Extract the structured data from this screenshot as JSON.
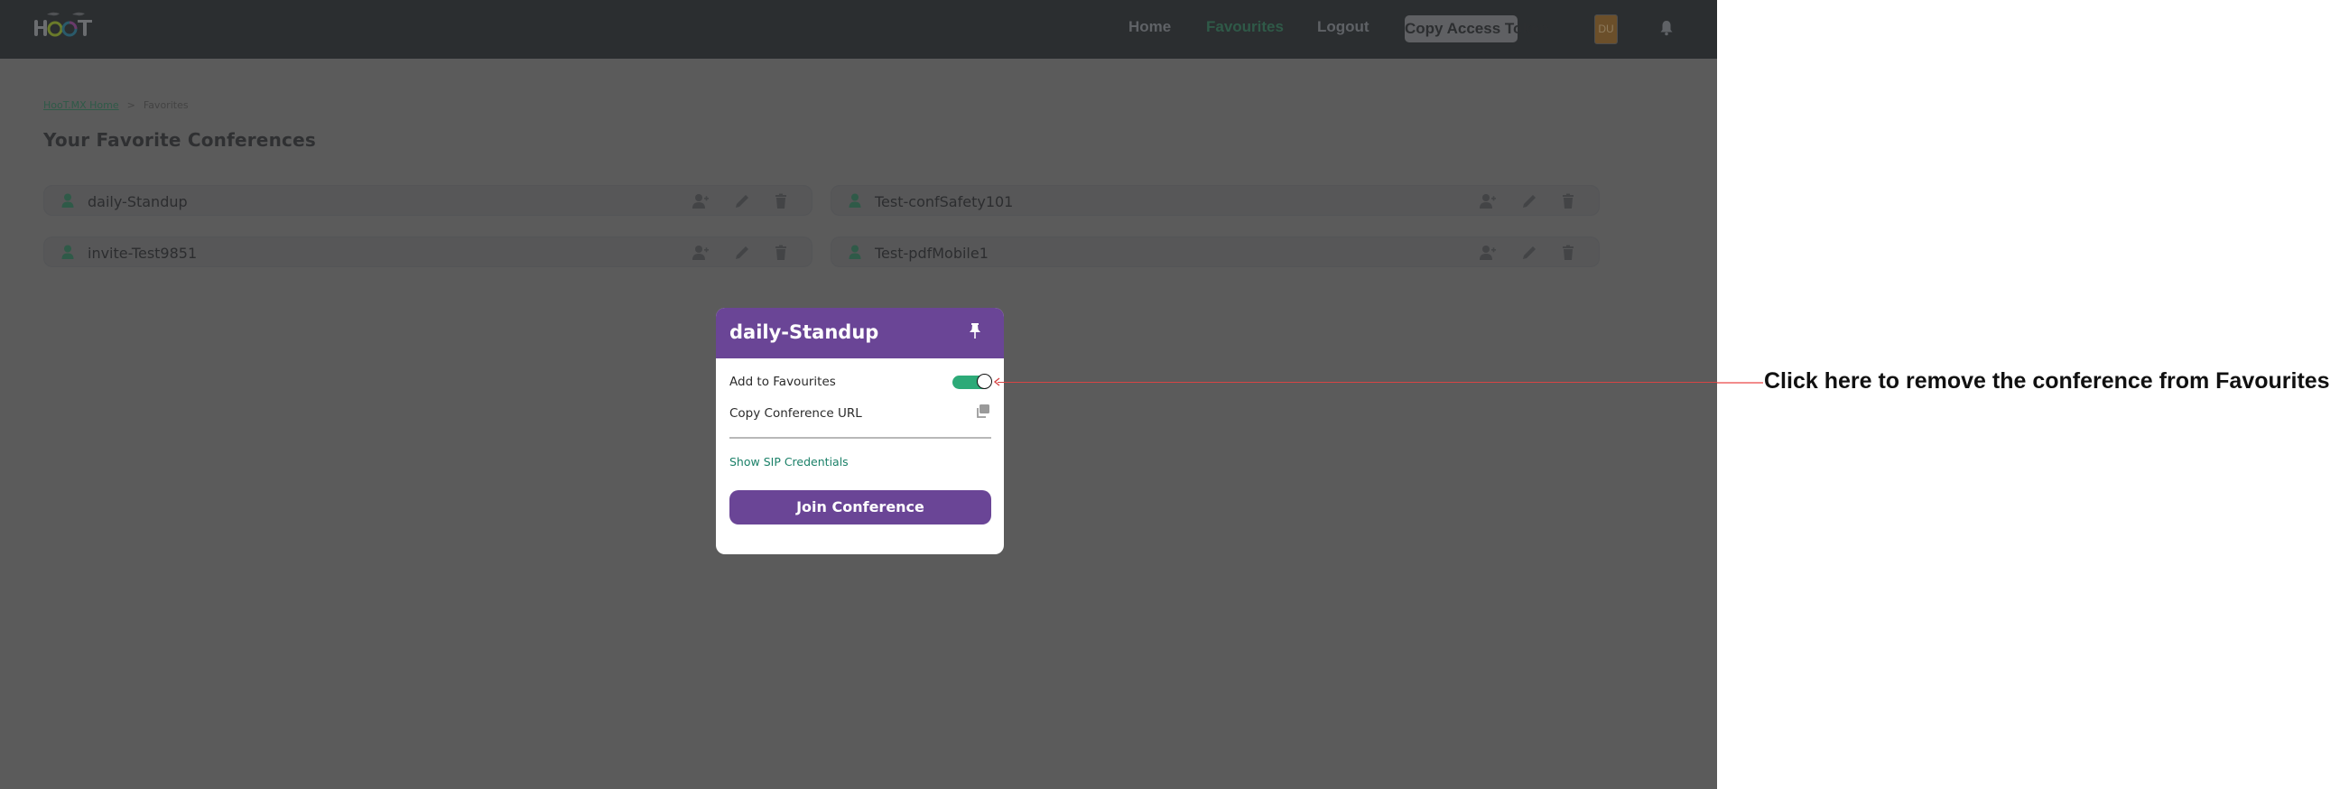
{
  "header": {
    "logo_text": "HooT",
    "nav": [
      {
        "label": "Home",
        "active": false
      },
      {
        "label": "Favourites",
        "active": true
      },
      {
        "label": "Logout",
        "active": false
      }
    ],
    "copy_token_label": "Copy Access Token",
    "avatar_initials": "DU",
    "notification_icon": "bell-icon"
  },
  "breadcrumb": {
    "home_label": "HooT.MX Home",
    "separator": ">",
    "current": "Favorites"
  },
  "page_title": "Your Favorite Conferences",
  "conferences": [
    {
      "name": "daily-Standup",
      "icon": "user-icon",
      "actions": [
        "invite-user-icon",
        "edit-icon",
        "delete-icon"
      ]
    },
    {
      "name": "Test-confSafety101",
      "icon": "user-icon",
      "actions": [
        "invite-user-icon",
        "edit-icon",
        "delete-icon"
      ]
    },
    {
      "name": "invite-Test9851",
      "icon": "user-icon",
      "actions": [
        "invite-user-icon",
        "edit-icon",
        "delete-icon"
      ]
    },
    {
      "name": "Test-pdfMobile1",
      "icon": "user-icon",
      "actions": [
        "invite-user-icon",
        "edit-icon",
        "delete-icon"
      ]
    }
  ],
  "modal": {
    "title": "daily-Standup",
    "pin_icon": "pin-icon",
    "favourite_label": "Add to Favourites",
    "favourite_enabled": true,
    "copy_url_label": "Copy Conference URL",
    "copy_icon": "copy-icon",
    "sip_link_label": "Show SIP Credentials",
    "join_button_label": "Join Conference"
  },
  "annotation": {
    "text": "Click here to remove the conference from Favourites"
  },
  "colors": {
    "brand_purple": "#6a4596",
    "toggle_on": "#2daa78",
    "link_green": "#1b8068",
    "annotation_red": "#d64545"
  }
}
